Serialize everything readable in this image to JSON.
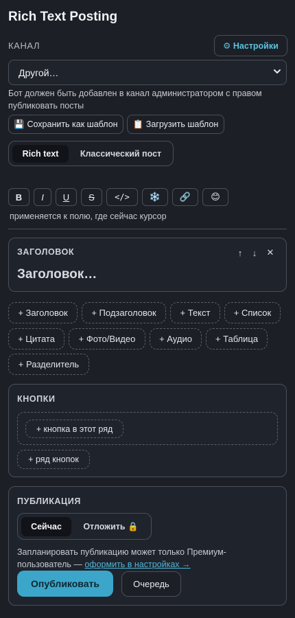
{
  "app": {
    "title": "Rich Text Posting"
  },
  "channel": {
    "label": "КАНАЛ",
    "settings_label": "⚙ Настройки",
    "selected": "Другой…",
    "hint": "Бот должен быть добавлен в канал администратором с правом публиковать посты",
    "save_template": "💾 Сохранить как шаблон",
    "load_template": "📋 Загрузить шаблон"
  },
  "mode_tabs": [
    {
      "label": "Rich text",
      "active": true
    },
    {
      "label": "Классический пост",
      "active": false
    }
  ],
  "format_toolbar": {
    "buttons": [
      "B",
      "I",
      "U",
      "S",
      "</>",
      "❄️",
      "🔗",
      "😊"
    ],
    "hint": "применяется к полю, где сейчас курсор"
  },
  "heading_block": {
    "label": "ЗАГОЛОВОК",
    "up": "↑",
    "down": "↓",
    "close": "✕",
    "placeholder": "Заголовок…"
  },
  "add_blocks": [
    "+ Заголовок",
    "+ Подзаголовок",
    "+ Текст",
    "+ Список",
    "+ Цитата",
    "+ Фото/Видео",
    "+ Аудио",
    "+ Таблица",
    "+ Разделитель"
  ],
  "buttons_section": {
    "label": "КНОПКИ",
    "add_in_row": "+ кнопка в этот ряд",
    "add_row": "+ ряд кнопок"
  },
  "publication": {
    "label": "ПУБЛИКАЦИЯ",
    "tabs": [
      {
        "label": "Сейчас",
        "active": true
      },
      {
        "label": "Отложить 🔒",
        "active": false
      }
    ],
    "note": "Запланировать публикацию может только Премиум-пользователь — ",
    "note_link": "оформить в настройках →",
    "publish": "Опубликовать",
    "queue": "Очередь"
  },
  "colors": {
    "accent": "#3ba6c9",
    "background": "#1c1f26",
    "border": "#4a4f5a"
  }
}
